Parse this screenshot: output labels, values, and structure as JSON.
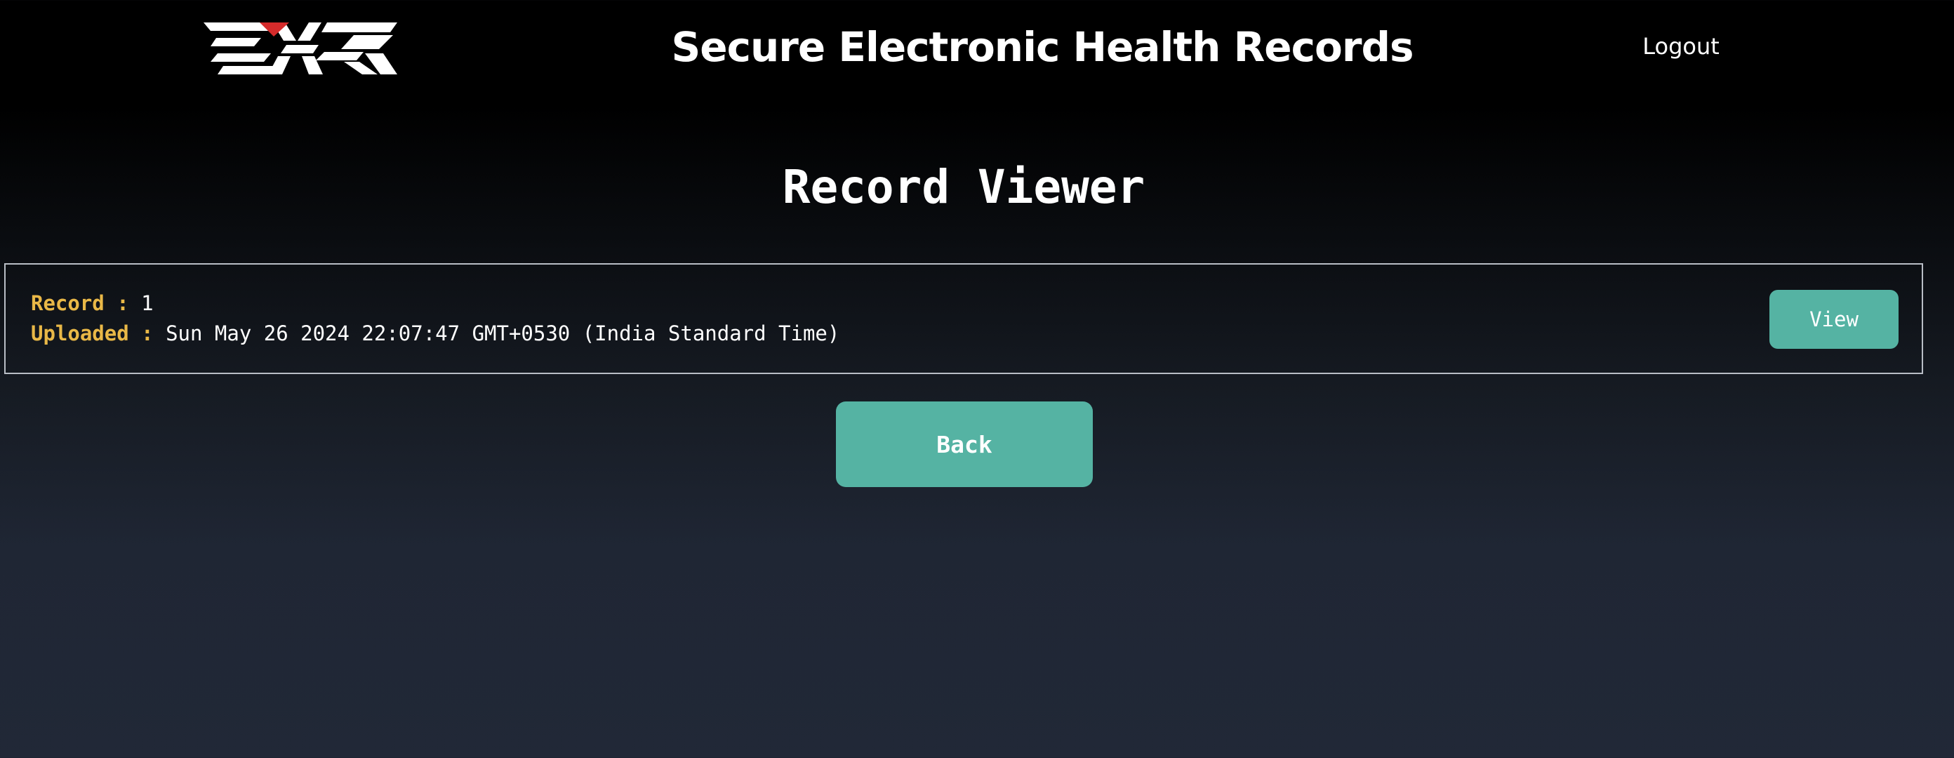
{
  "header": {
    "logo_text": "EHR",
    "title": "Secure Electronic Health Records",
    "logout_label": "Logout"
  },
  "main": {
    "page_title": "Record Viewer",
    "records": [
      {
        "record_label": "Record :",
        "record_value": "1",
        "uploaded_label": "Uploaded :",
        "uploaded_value": "Sun May 26 2024 22:07:47 GMT+0530 (India Standard Time)",
        "view_label": "View"
      }
    ],
    "back_label": "Back"
  },
  "colors": {
    "accent": "#55b3a3",
    "label": "#e9b847",
    "logo_mark": "#d52b2b",
    "background_top": "#000000",
    "background_bottom": "#212837"
  }
}
